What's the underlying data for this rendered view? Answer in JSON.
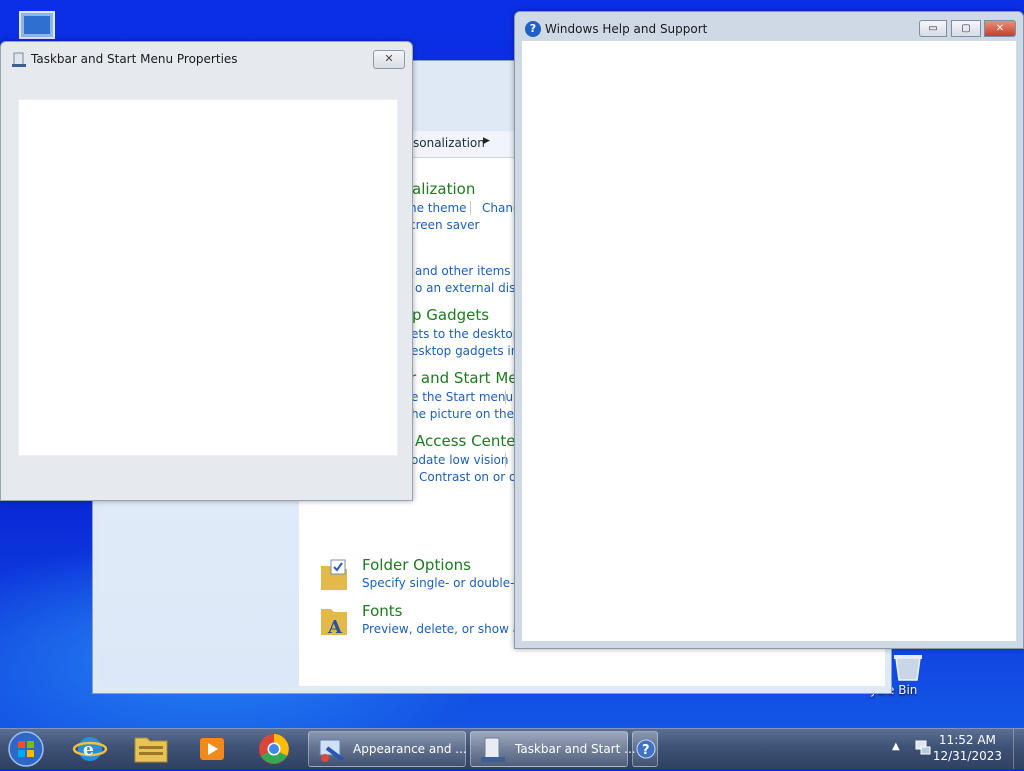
{
  "desktop": {
    "recycle_bin_label": "ycle Bin"
  },
  "control_panel": {
    "breadcrumb": "sonalization",
    "categories": [
      {
        "title": "alization",
        "links": [
          "he theme",
          "Chang",
          "creen saver"
        ]
      },
      {
        "title": "",
        "links": [
          "and other items lar",
          "o an external displa"
        ]
      },
      {
        "title": "p Gadgets",
        "links": [
          "ets to the desktop",
          "esktop gadgets insta"
        ]
      },
      {
        "title": "r and Start Men",
        "links": [
          "e the Start menu",
          "he picture on the St"
        ]
      },
      {
        "title": "Access Center",
        "links": [
          "odate low vision",
          "Contrast on or off"
        ]
      },
      {
        "title": "Folder Options",
        "links": [
          "Specify single- or double-clic"
        ]
      },
      {
        "title": "Fonts",
        "links": [
          "Preview, delete, or show and"
        ]
      }
    ]
  },
  "taskbar_properties": {
    "title": "Taskbar and Start Menu Properties",
    "close_glyph": "✕"
  },
  "help_window": {
    "title": "Windows Help and Support",
    "minimize_glyph": "▭",
    "maximize_glyph": "▢",
    "close_glyph": "✕"
  },
  "taskbar": {
    "pinned": [
      {
        "name": "internet-explorer",
        "color": "#2a8de0"
      },
      {
        "name": "windows-explorer",
        "color": "#e8c35a"
      },
      {
        "name": "media-player",
        "color": "#f08a1a"
      },
      {
        "name": "chrome",
        "color": "#34a853"
      }
    ],
    "buttons": [
      {
        "label": "Appearance and ..."
      },
      {
        "label": "Taskbar and Start ..."
      }
    ],
    "clock_time": "11:52 AM",
    "clock_date": "12/31/2023"
  },
  "colors": {
    "desktop_blue": "#0a2de0",
    "link_blue": "#1b60b8",
    "category_green": "#1e7a1e"
  }
}
